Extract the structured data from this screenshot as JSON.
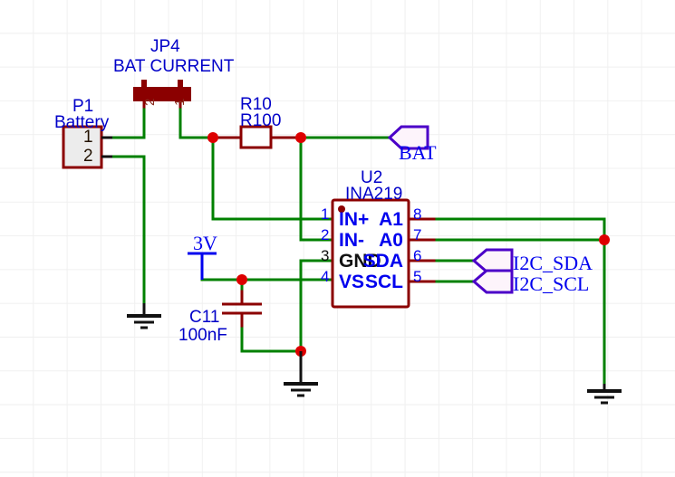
{
  "diagram": {
    "type": "electrical-schematic",
    "title_shown": false,
    "colors": {
      "wire": "#008000",
      "component_outline": "#8b0000",
      "junction_dot": "#dd0000",
      "reference_text": "#0000c8",
      "pin_name_text": "#0000ee",
      "net_label_text": "#0000ee",
      "ground_symbol": "#000000",
      "power_symbol": "#0000ee",
      "grid": "#f0f0f0",
      "background": "#ffffff"
    }
  },
  "components": {
    "jp4": {
      "ref": "JP4",
      "value": "BAT CURRENT",
      "pin_2": "2",
      "pin_1": "1"
    },
    "p1": {
      "ref": "P1",
      "value": "Battery",
      "pins": [
        {
          "num": "1"
        },
        {
          "num": "2"
        }
      ]
    },
    "r10": {
      "ref": "R10",
      "value": "R100"
    },
    "u2": {
      "ref": "U2",
      "value": "INA219",
      "left_pins": [
        {
          "num": "1",
          "name": "IN+"
        },
        {
          "num": "2",
          "name": "IN-"
        },
        {
          "num": "3",
          "name": "GND"
        },
        {
          "num": "4",
          "name": "VS"
        }
      ],
      "right_pins": [
        {
          "num": "8",
          "name": "A1"
        },
        {
          "num": "7",
          "name": "A0"
        },
        {
          "num": "6",
          "name": "SDA"
        },
        {
          "num": "5",
          "name": "SCL"
        }
      ]
    },
    "c11": {
      "ref": "C11",
      "value": "100nF"
    }
  },
  "power_symbols": [
    {
      "name": "3v-power-flag",
      "label": "3V"
    }
  ],
  "net_labels": [
    {
      "name": "bat",
      "label": "BAT",
      "direction": "input"
    },
    {
      "name": "i2c-sda",
      "label": "I2C_SDA",
      "direction": "bidirectional"
    },
    {
      "name": "i2c-scl",
      "label": "I2C_SCL",
      "direction": "bidirectional"
    }
  ],
  "ground_symbols": [
    {
      "name": "gnd-battery"
    },
    {
      "name": "gnd-c11"
    },
    {
      "name": "gnd-right"
    }
  ]
}
